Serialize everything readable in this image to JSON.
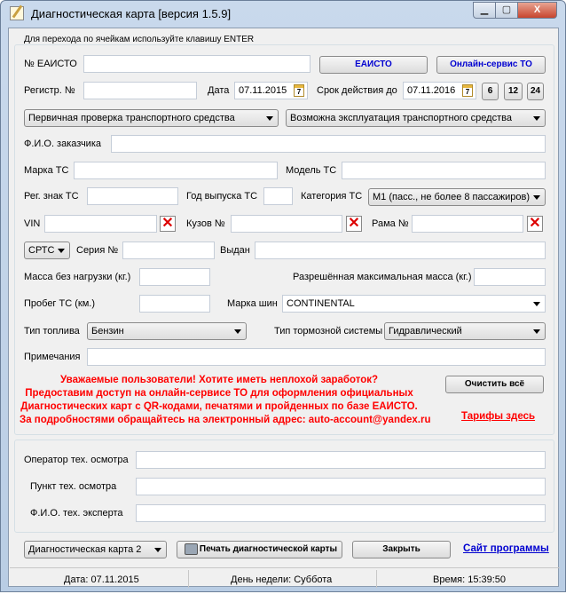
{
  "window": {
    "title": "Диагностическая карта [версия 1.5.9]",
    "minimize": "▁",
    "maximize": "▢",
    "close": "X"
  },
  "group1_label": "Для перехода по ячейкам используйте клавишу ENTER",
  "eaisto": {
    "label": "№ ЕАИСТО",
    "value": "",
    "btn_eaisto": "ЕАИСТО",
    "btn_online": "Онлайн-сервис ТО"
  },
  "reg": {
    "label": "Регистр. №",
    "value": "",
    "date_label": "Дата",
    "date": "07.11.2015",
    "valid_label": "Срок действия до",
    "valid_date": "07.11.2016",
    "cal_day": "7",
    "btn6": "6",
    "btn12": "12",
    "btn24": "24"
  },
  "check_type": "Первичная проверка транспортного средства",
  "result": "Возможна эксплуатация транспортного средства",
  "customer_label": "Ф.И.О. заказчика",
  "make_label": "Марка ТС",
  "model_label": "Модель ТС",
  "plate_label": "Рег. знак ТС",
  "year_label": "Год выпуска ТС",
  "category_label": "Категория ТС",
  "category": "M1 (пасс., не более 8 пассажиров)",
  "vin_label": "VIN",
  "body_label": "Кузов №",
  "frame_label": "Рама №",
  "clear_x": "✕",
  "doc_type": "СРТС",
  "series_label": "Серия №",
  "issued_label": "Выдан",
  "mass_label": "Масса без нагрузки (кг.)",
  "max_mass_label": "Разрешённая максимальная масса (кг.)",
  "mileage_label": "Пробег ТС (км.)",
  "tires_label": "Марка шин",
  "tires": "CONTINENTAL",
  "fuel_label": "Тип топлива",
  "fuel": "Бензин",
  "brake_label": "Тип тормозной системы",
  "brake": "Гидравлический",
  "notes_label": "Примечания",
  "ad": [
    "Уважаемые пользователи!    Хотите иметь неплохой заработок?",
    "Предоставим доступ на онлайн-сервисе ТО для оформления официальных",
    "Диагностических карт с QR-кодами, печатями и пройденных по базе ЕАИСТО.",
    "За подробностями обращайтесь на электронный адрес: auto-account@yandex.ru"
  ],
  "clear_all": "Очистить всё",
  "tariffs": "Тарифы здесь",
  "operator_label": "Оператор тех. осмотра",
  "point_label": "Пункт тех. осмотра",
  "expert_label": "Ф.И.О. тех. эксперта",
  "card_select": "Диагностическая карта 2",
  "print": "Печать диагностической карты",
  "close_btn": "Закрыть",
  "site": "Сайт программы",
  "status": {
    "date": "Дата: 07.11.2015",
    "weekday": "День недели: Суббота",
    "time": "Время: 15:39:50"
  }
}
